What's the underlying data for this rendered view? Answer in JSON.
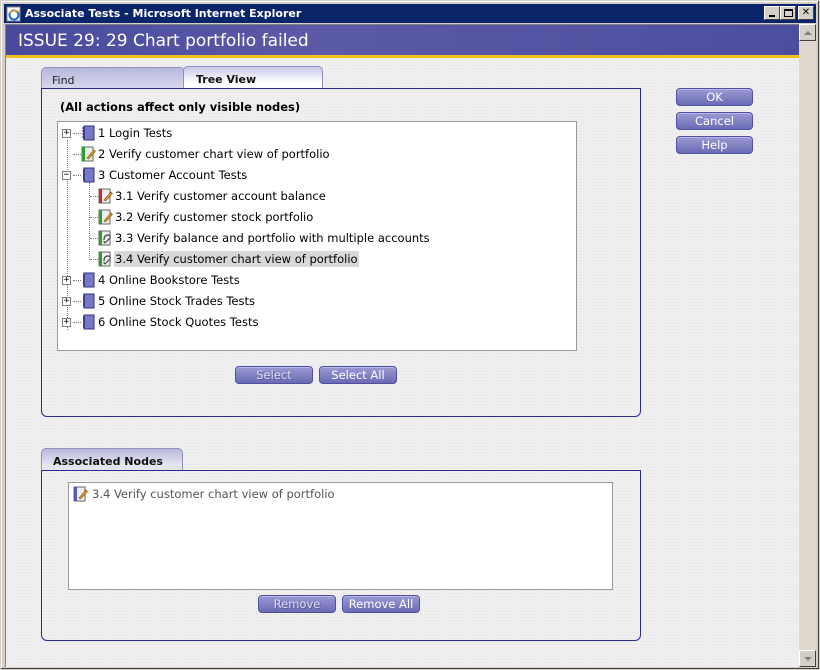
{
  "window": {
    "title": "Associate Tests - Microsoft Internet Explorer",
    "buttons": [
      "minimize",
      "maximize",
      "close"
    ]
  },
  "header": {
    "title": "ISSUE 29: 29 Chart portfolio failed"
  },
  "tabs": [
    {
      "label": "Find",
      "active": false
    },
    {
      "label": "Tree View",
      "active": true
    }
  ],
  "tree_panel": {
    "notice": "(All actions affect only visible nodes)",
    "nodes": [
      {
        "label": "1 Login Tests",
        "type": "folder",
        "expander": "+",
        "level": 0
      },
      {
        "label": "2 Verify customer chart view of portfolio",
        "type": "test-pass-edit",
        "expander": null,
        "level": 0
      },
      {
        "label": "3 Customer Account Tests",
        "type": "folder",
        "expander": "-",
        "level": 0
      },
      {
        "label": "3.1 Verify customer account balance",
        "type": "test-fail-edit",
        "expander": null,
        "level": 1
      },
      {
        "label": "3.2 Verify customer stock portfolio",
        "type": "test-pass-edit",
        "expander": null,
        "level": 1
      },
      {
        "label": "3.3 Verify balance and portfolio with multiple accounts",
        "type": "test-pass-linked",
        "expander": null,
        "level": 1
      },
      {
        "label": "3.4 Verify customer chart view of portfolio",
        "type": "test-pass-linked",
        "expander": null,
        "level": 1,
        "selected": true
      },
      {
        "label": "4 Online Bookstore Tests",
        "type": "folder",
        "expander": "+",
        "level": 0
      },
      {
        "label": "5 Online Stock Trades Tests",
        "type": "folder",
        "expander": "+",
        "level": 0
      },
      {
        "label": "6 Online Stock Quotes Tests",
        "type": "folder",
        "expander": "+",
        "level": 0
      }
    ],
    "select_label": "Select",
    "select_all_label": "Select All"
  },
  "associated_panel": {
    "tab_label": "Associated Nodes",
    "items": [
      {
        "label": "3.4 Verify customer chart view of portfolio",
        "icon": "test-edit-icon"
      }
    ],
    "remove_label": "Remove",
    "remove_all_label": "Remove All"
  },
  "side_buttons": {
    "ok": "OK",
    "cancel": "Cancel",
    "help": "Help"
  },
  "colors": {
    "titlebar": "#0a246a",
    "header_band": "#4d4d9e",
    "header_accent": "#f0c020",
    "panel_border": "#2a2a90",
    "button": "#7a7ac0",
    "pass": "#2e9e2e",
    "fail": "#d02828"
  }
}
